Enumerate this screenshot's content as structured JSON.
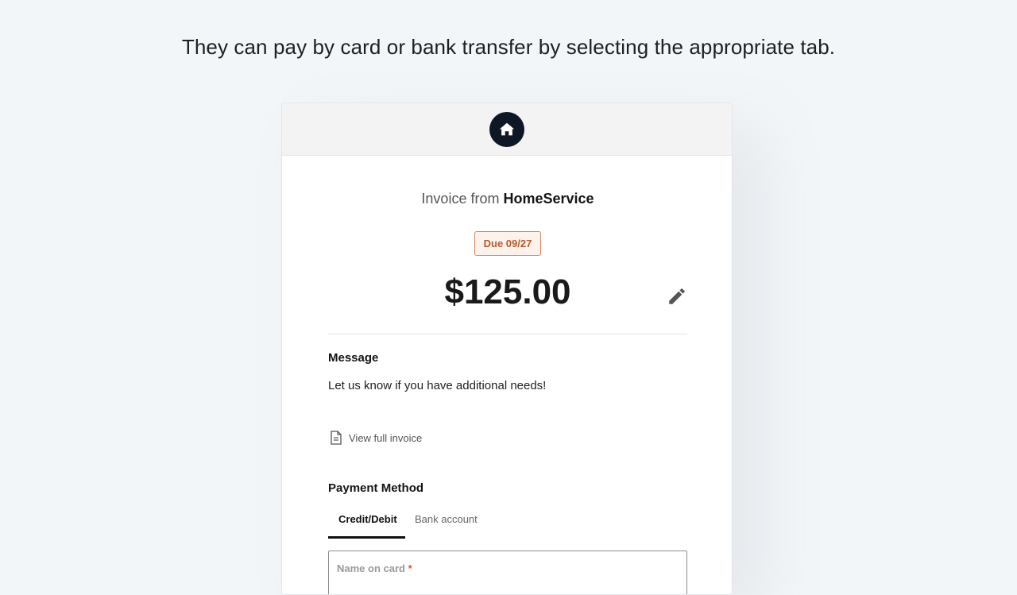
{
  "caption": "They can pay by card or bank transfer by selecting the appropriate tab.",
  "invoice": {
    "from_prefix": "Invoice from",
    "business_name": "HomeService",
    "due_label": "Due 09/27",
    "amount": "$125.00",
    "message_label": "Message",
    "message_text": "Let us know if you have additional needs!",
    "view_full_invoice": "View full invoice"
  },
  "payment": {
    "label": "Payment Method",
    "tabs": [
      {
        "label": "Credit/Debit",
        "active": true
      },
      {
        "label": "Bank account",
        "active": false
      }
    ],
    "name_on_card_label": "Name on card",
    "required_mark": "*"
  },
  "icons": {
    "logo": "home-icon",
    "edit": "pencil-icon",
    "document": "document-icon"
  },
  "colors": {
    "logo_bg": "#0e1726",
    "due_border": "#d9855a",
    "due_text": "#b55a2c",
    "required": "#d9582e"
  }
}
